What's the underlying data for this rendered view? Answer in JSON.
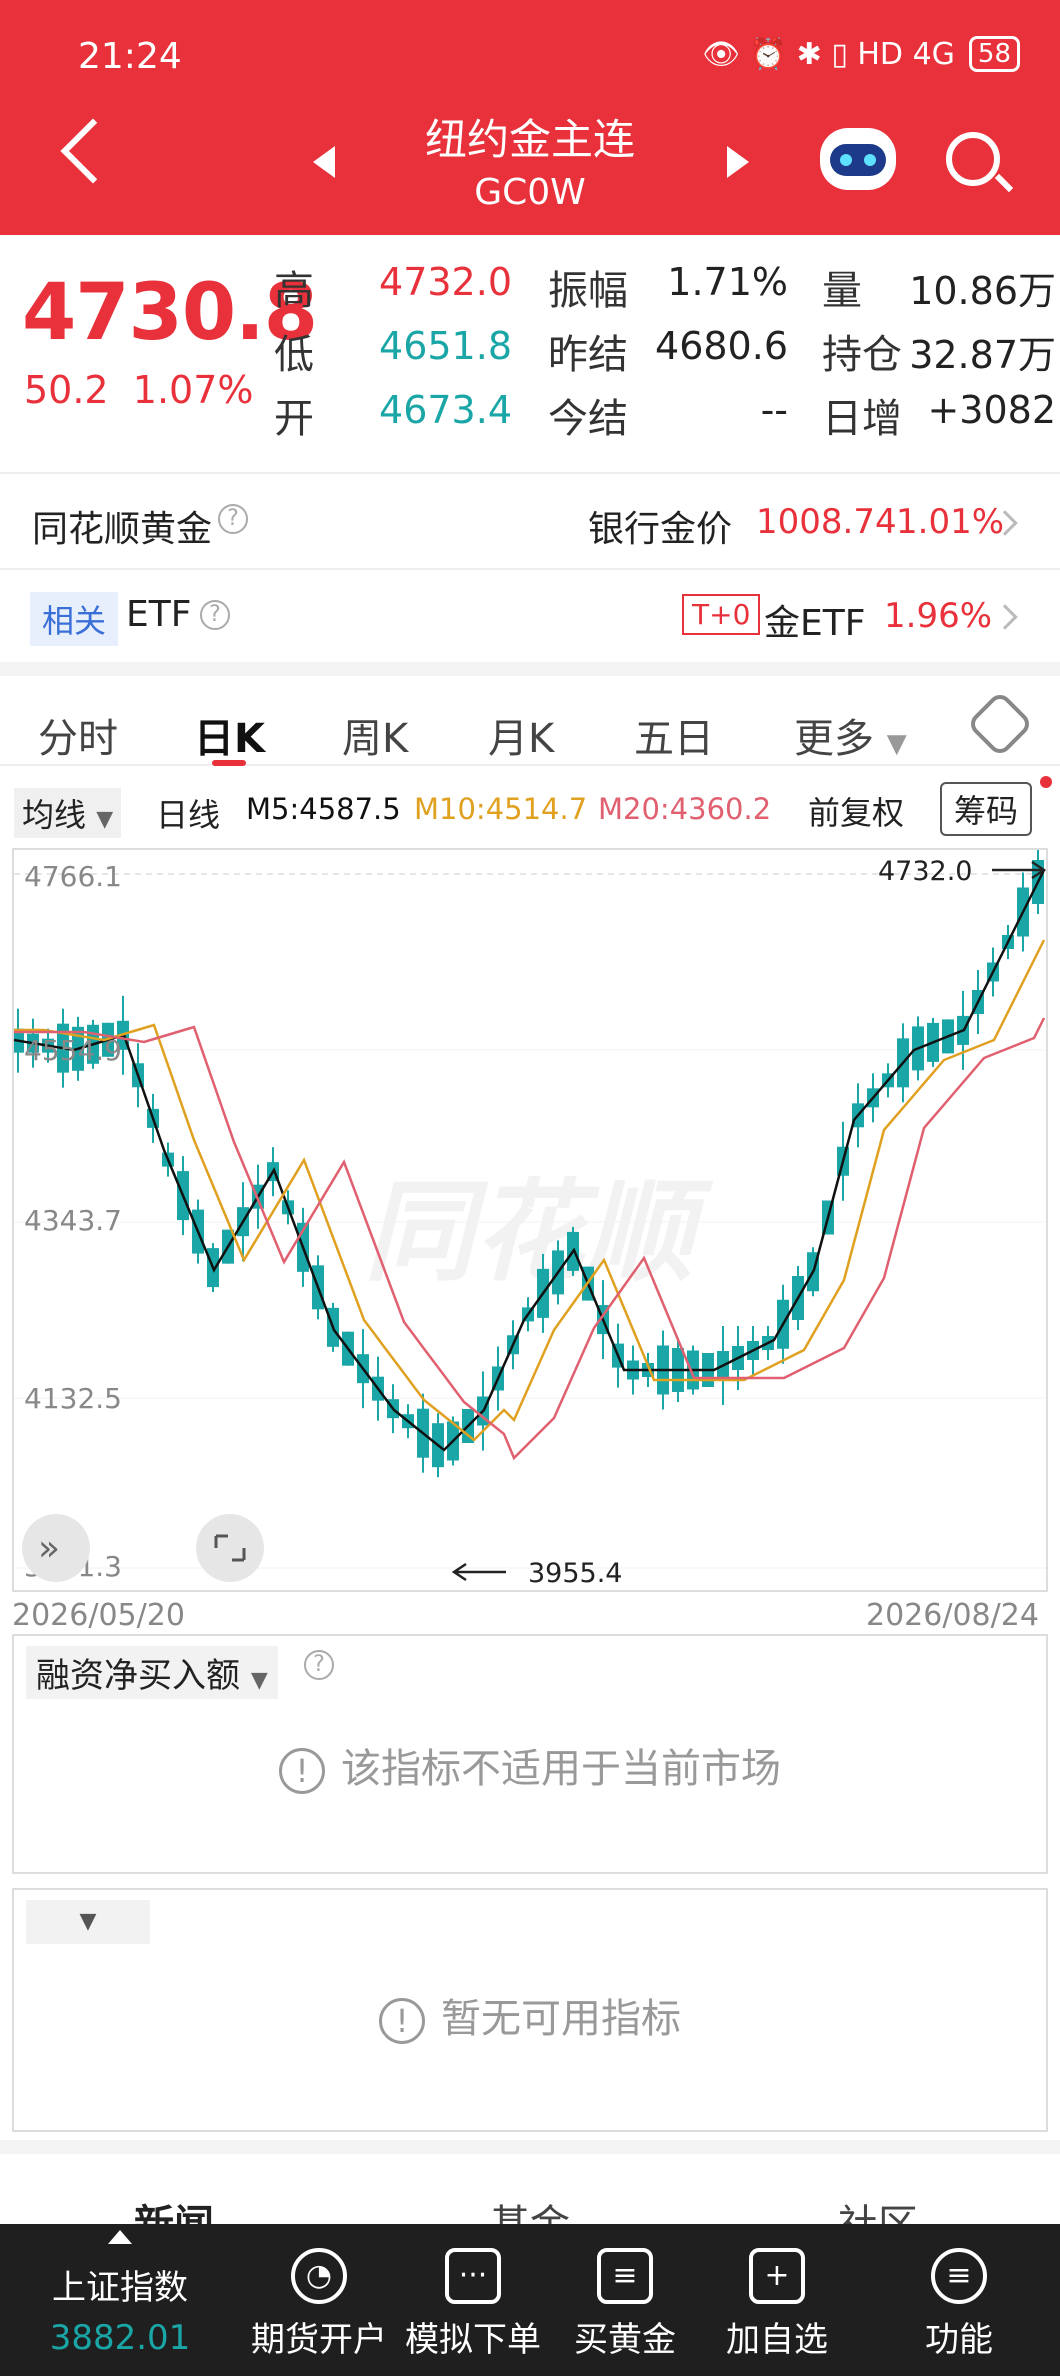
{
  "status": {
    "time": "21:24",
    "battery": "58",
    "icons": "👁 ⏰ ✱ ▯ HD 4G"
  },
  "header": {
    "title": "纽约金主连",
    "code": "GC0W"
  },
  "quote": {
    "price": "4730.8",
    "change": "50.2",
    "pct": "1.07%",
    "labels": {
      "high": "高",
      "low": "低",
      "open": "开",
      "amp": "振幅",
      "prev": "昨结",
      "today": "今结",
      "vol": "量",
      "oi": "持仓",
      "add": "日增"
    },
    "values": {
      "high": "4732.0",
      "low": "4651.8",
      "open": "4673.4",
      "amp": "1.71%",
      "prev": "4680.6",
      "today": "--",
      "vol": "10.86万",
      "oi": "32.87万",
      "add": "+3082"
    }
  },
  "row1": {
    "left": "同花顺黄金",
    "label": "银行金价",
    "price": "1008.74",
    "pct": "1.01%"
  },
  "row2": {
    "tag": "相关",
    "left": "ETF",
    "badge": "T+0",
    "label": "金ETF",
    "pct": "1.96%"
  },
  "tabs": [
    "分时",
    "日K",
    "周K",
    "月K",
    "五日",
    "更多"
  ],
  "legend": {
    "ma": "均线",
    "period": "日线",
    "m5": "M5:4587.5",
    "m10": "M10:4514.7",
    "m20": "M20:4360.2",
    "adj": "前复权",
    "chips": "筹码"
  },
  "chart_data": {
    "type": "candlestick",
    "y_ticks": [
      "4766.1",
      "4554.9",
      "4343.7",
      "4132.5",
      "3921.3"
    ],
    "ylim": [
      3921.3,
      4766.1
    ],
    "x_labels": [
      "2026/05/20",
      "2026/08/24"
    ],
    "max_label": "4732.0",
    "min_label": "3955.4",
    "colors": {
      "up": "#e8313a",
      "down": "#1aa6a6",
      "m5": "#111111",
      "m10": "#e0a020",
      "m20": "#e06070"
    }
  },
  "ind1": {
    "title": "融资净买入额",
    "msg": "该指标不适用于当前市场"
  },
  "ind2": {
    "msg": "暂无可用指标"
  },
  "news": [
    "新闻",
    "基金",
    "社区"
  ],
  "bottom": {
    "index_name": "上证指数",
    "index_val": "3882.01",
    "items": [
      "期货开户",
      "模拟下单",
      "买黄金",
      "加自选",
      "功能"
    ]
  }
}
